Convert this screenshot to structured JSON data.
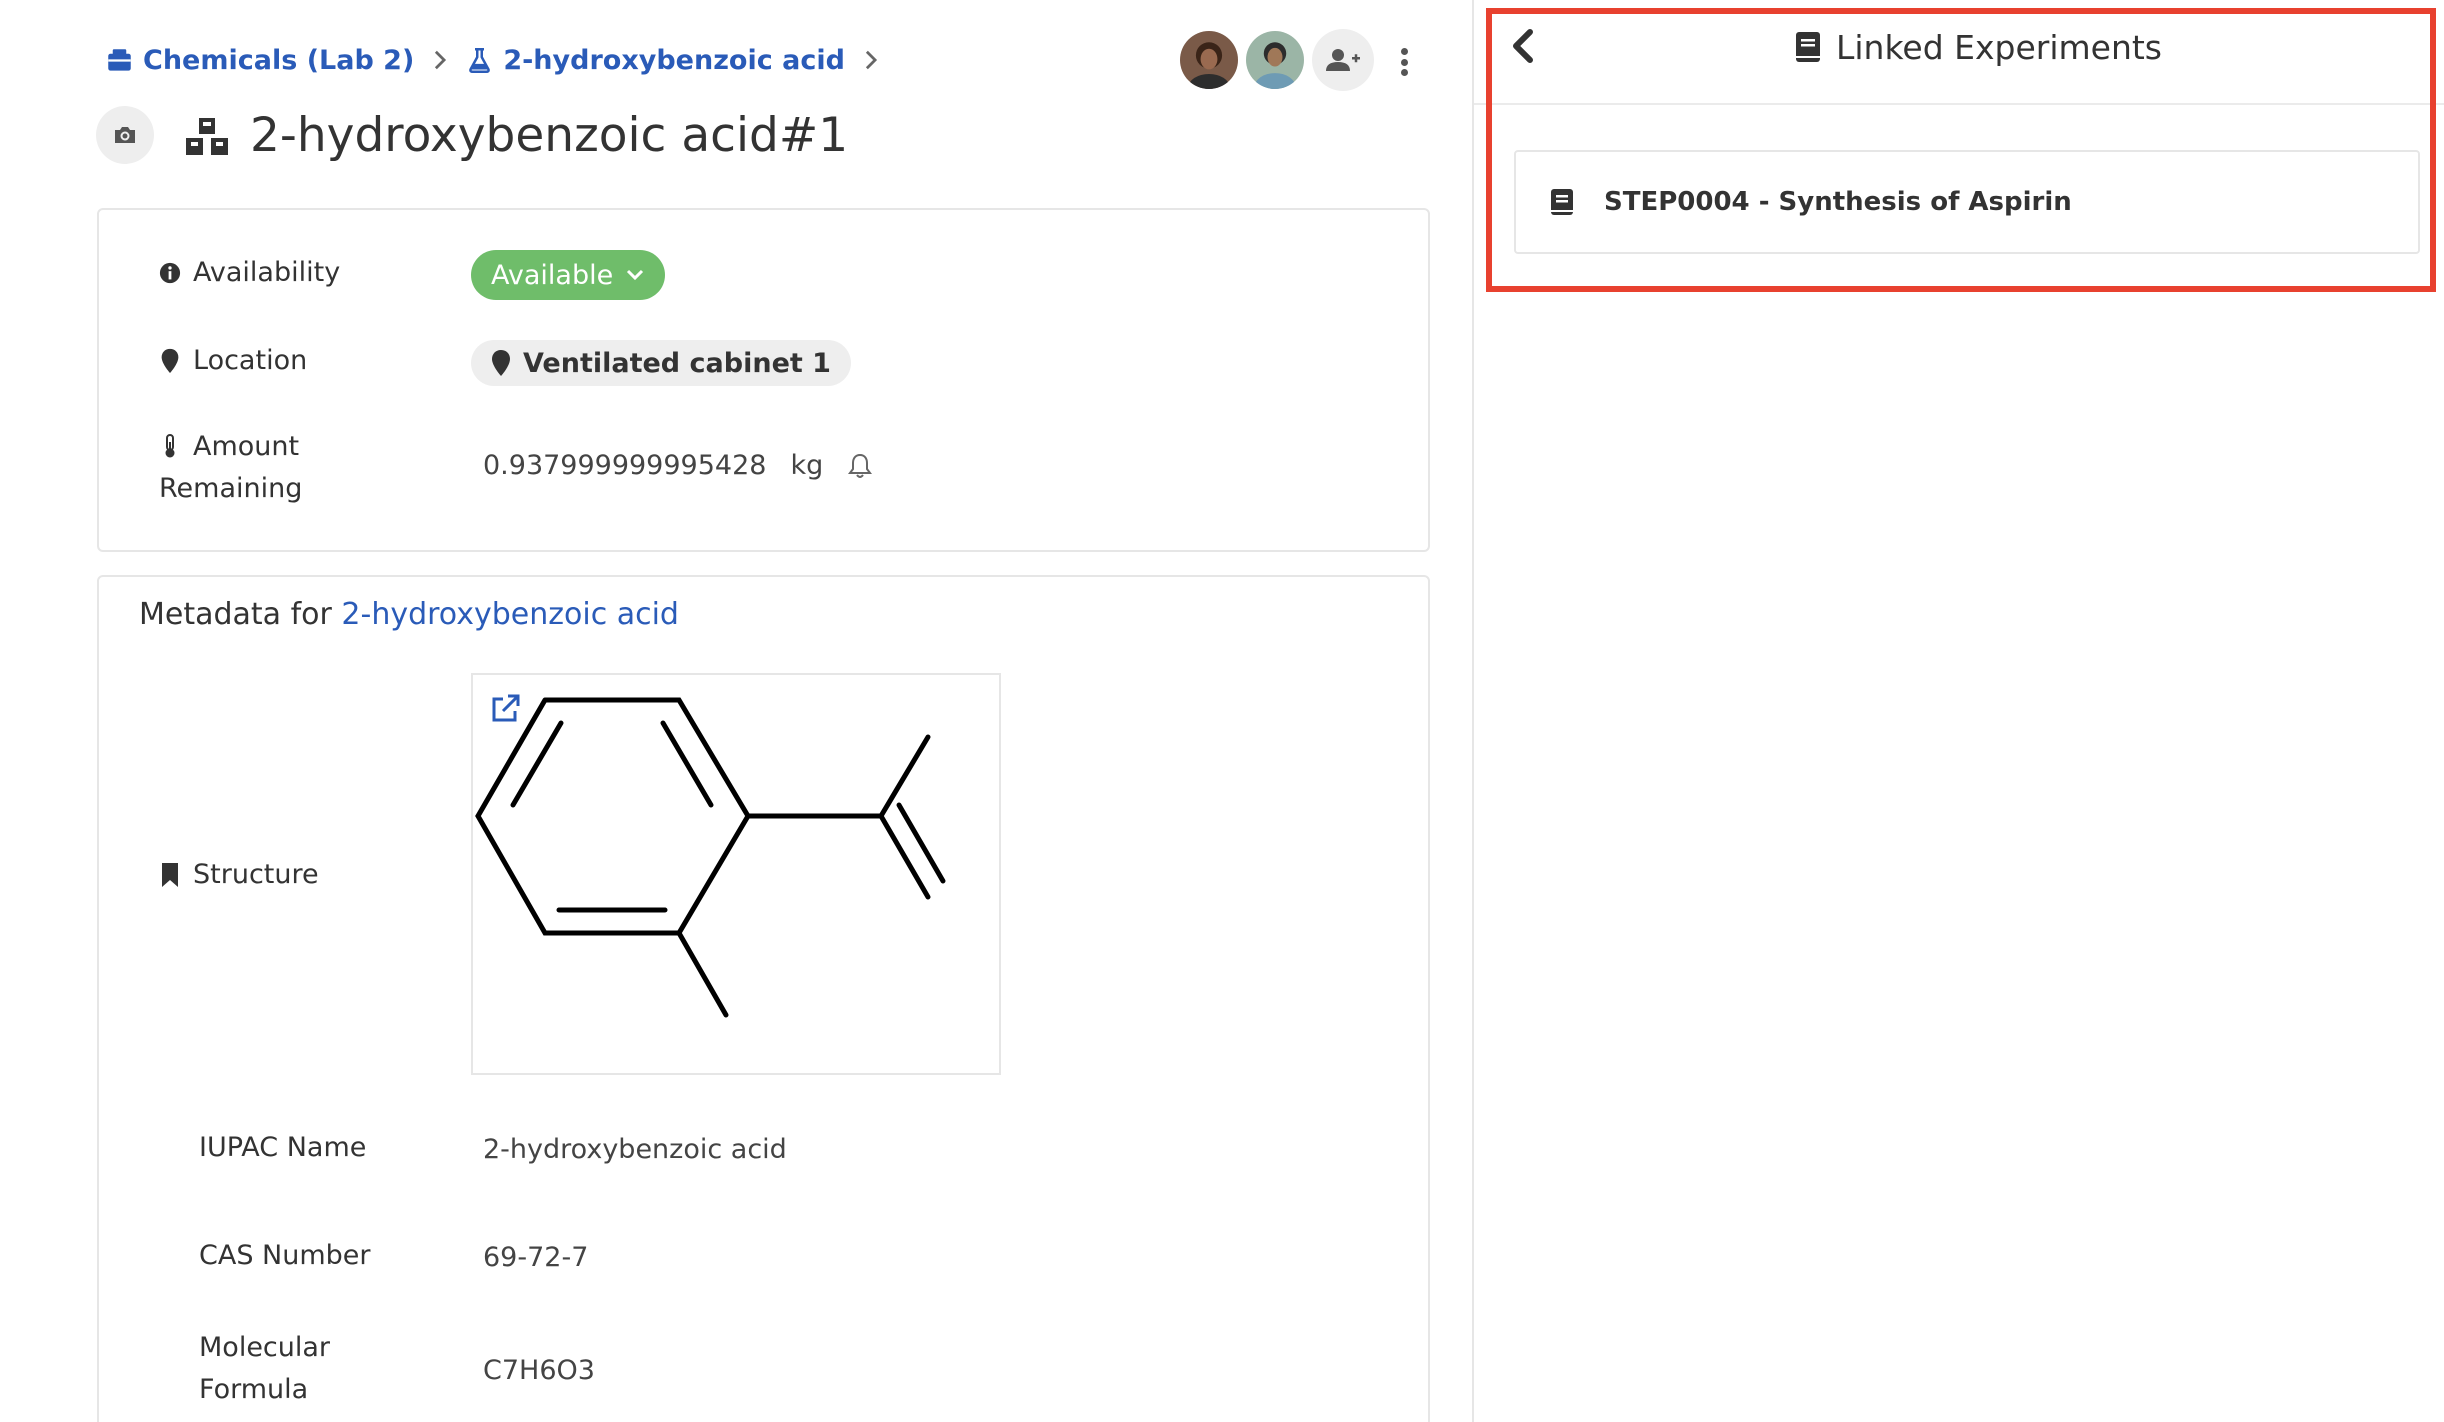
{
  "breadcrumb": {
    "items": [
      {
        "label": "Chemicals (Lab 2)",
        "icon": "container-icon"
      },
      {
        "label": "2-hydroxybenzoic acid",
        "icon": "flask-icon"
      }
    ]
  },
  "header": {
    "title": "2-hydroxybenzoic acid#1"
  },
  "details": {
    "availability": {
      "label": "Availability",
      "value": "Available"
    },
    "location": {
      "label": "Location",
      "value": "Ventilated cabinet 1"
    },
    "amount": {
      "label_line1": "Amount",
      "label_line2": "Remaining",
      "value": "0.937999999995428",
      "unit": "kg"
    }
  },
  "metadata": {
    "heading_prefix": "Metadata for",
    "heading_link": "2-hydroxybenzoic acid",
    "structure_label": "Structure",
    "iupac": {
      "label": "IUPAC Name",
      "value": "2-hydroxybenzoic acid"
    },
    "cas": {
      "label": "CAS Number",
      "value": "69-72-7"
    },
    "formula": {
      "label_line1": "Molecular",
      "label_line2": "Formula",
      "value": "C7H6O3"
    }
  },
  "linked_panel": {
    "title": "Linked Experiments",
    "items": [
      {
        "label": "STEP0004 - Synthesis of Aspirin"
      }
    ]
  },
  "colors": {
    "link": "#2a5bb8",
    "available": "#6fbd6a",
    "highlight": "#e8412f"
  }
}
